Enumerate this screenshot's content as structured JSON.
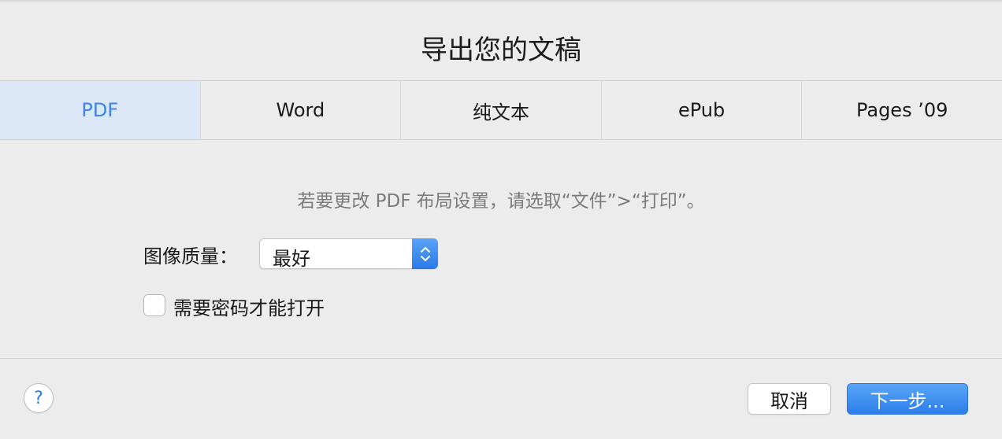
{
  "dialog": {
    "title": "导出您的文稿"
  },
  "tabs": [
    {
      "label": "PDF",
      "selected": true
    },
    {
      "label": "Word",
      "selected": false
    },
    {
      "label": "纯文本",
      "selected": false
    },
    {
      "label": "ePub",
      "selected": false
    },
    {
      "label": "Pages ’09",
      "selected": false
    }
  ],
  "pdf_options": {
    "hint": "若要更改 PDF 布局设置，请选取“文件”>“打印”。",
    "image_quality_label": "图像质量：",
    "image_quality_value": "最好",
    "password_label": "需要密码才能打开",
    "password_checked": false
  },
  "footer": {
    "help_label": "?",
    "cancel_label": "取消",
    "next_label": "下一步..."
  },
  "colors": {
    "accent": "#3a86e6",
    "selected_tab_bg": "#dce8f8",
    "background": "#ececec"
  }
}
